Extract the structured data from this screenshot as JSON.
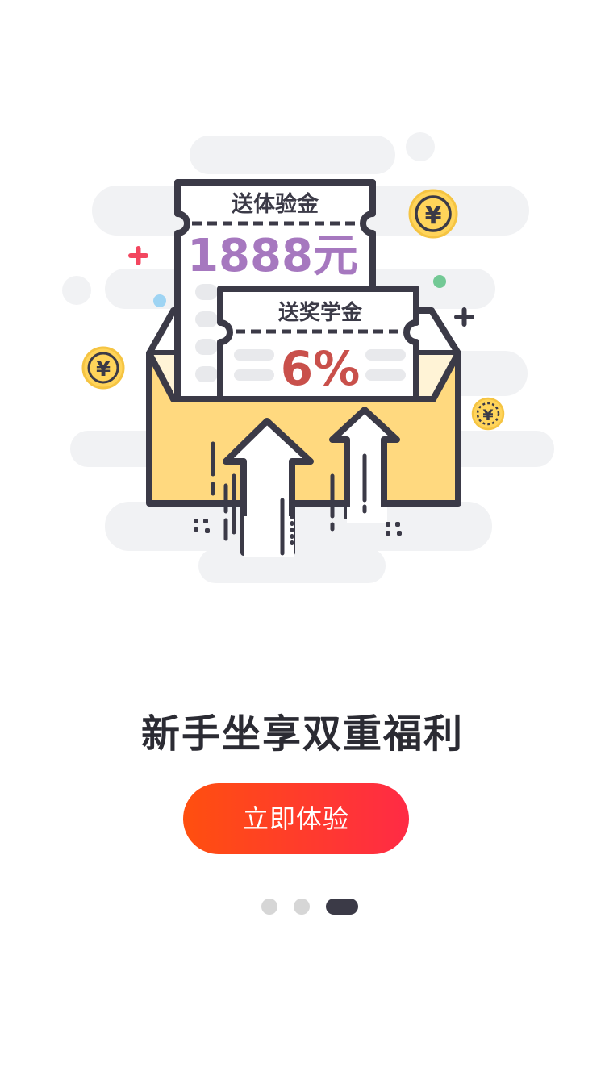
{
  "illustration": {
    "ticket_top": {
      "title": "送体验金",
      "value": "1888元"
    },
    "ticket_front": {
      "title": "送奖学金",
      "value": "6%"
    },
    "coin_symbol": "¥",
    "colors": {
      "ticket_value_purple": "#a678bf",
      "ticket_value_red": "#c9504b",
      "envelope_yellow": "#ffd97f",
      "outline": "#3b3a47",
      "coin": "#ffd45a",
      "cloud": "#f1f2f4"
    }
  },
  "headline": "新手坐享双重福利",
  "cta": {
    "label": "立即体验",
    "colors": [
      "#ff4f0f",
      "#ff2b45"
    ]
  },
  "pagination": {
    "total": 3,
    "active_index": 2
  }
}
